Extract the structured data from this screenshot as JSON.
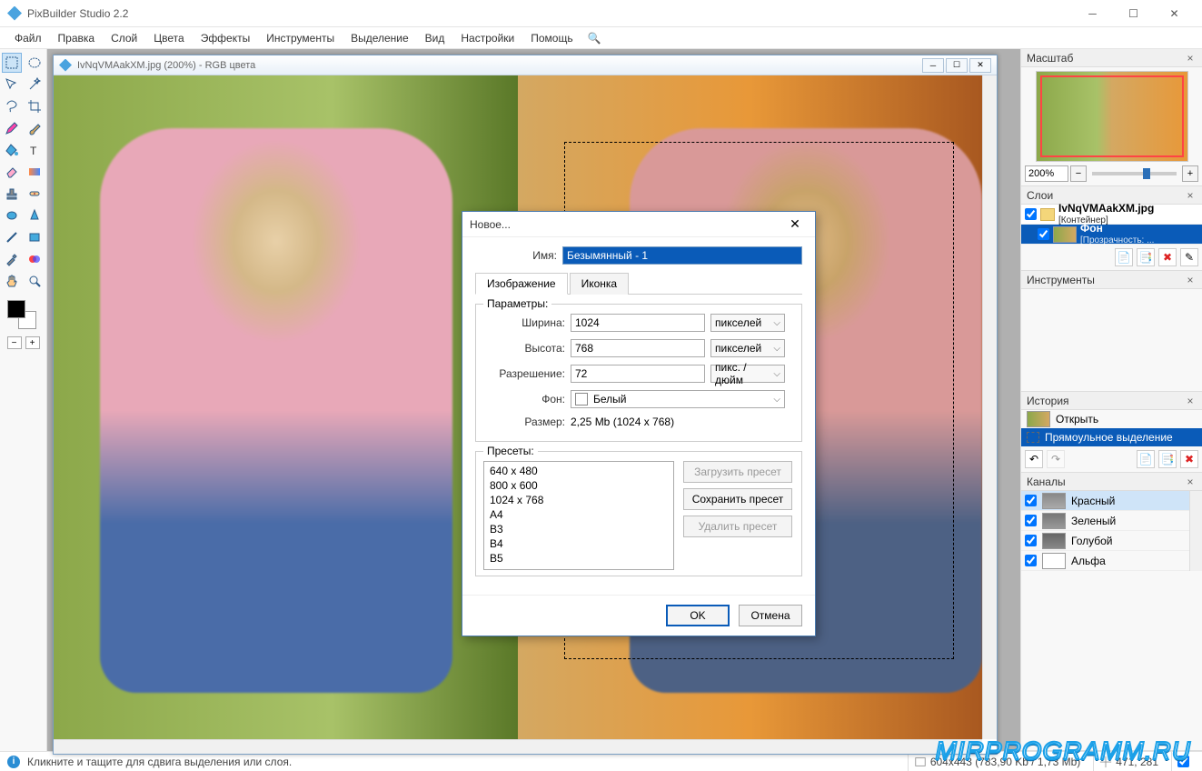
{
  "app": {
    "title": "PixBuilder Studio 2.2"
  },
  "menu": [
    "Файл",
    "Правка",
    "Слой",
    "Цвета",
    "Эффекты",
    "Инструменты",
    "Выделение",
    "Вид",
    "Настройки",
    "Помощь"
  ],
  "doc": {
    "title": "IvNqVMAakXM.jpg (200%) - RGB цвета"
  },
  "panels": {
    "navigator": {
      "title": "Масштаб",
      "zoom": "200%"
    },
    "layers": {
      "title": "Слои",
      "container": {
        "name": "IvNqVMAakXM.jpg",
        "sub": "[Контейнер]"
      },
      "layer": {
        "name": "Фон",
        "sub": "[Прозрачность: ..."
      }
    },
    "tools": {
      "title": "Инструменты"
    },
    "history": {
      "title": "История",
      "items": [
        "Открыть",
        "Прямоульное выделение"
      ]
    },
    "channels": {
      "title": "Каналы",
      "items": [
        "Красный",
        "Зеленый",
        "Голубой",
        "Альфа"
      ]
    }
  },
  "dialog": {
    "title": "Новое...",
    "name_label": "Имя:",
    "name_value": "Безымянный - 1",
    "tabs": [
      "Изображение",
      "Иконка"
    ],
    "params_legend": "Параметры:",
    "width_label": "Ширина:",
    "width_value": "1024",
    "width_unit": "пикселей",
    "height_label": "Высота:",
    "height_value": "768",
    "height_unit": "пикселей",
    "res_label": "Разрешение:",
    "res_value": "72",
    "res_unit": "пикс. / дюйм",
    "bg_label": "Фон:",
    "bg_value": "Белый",
    "size_label": "Размер:",
    "size_value": "2,25 Mb  (1024 x 768)",
    "presets_legend": "Пресеты:",
    "presets": [
      "640 x 480",
      "800 x 600",
      "1024 x 768",
      "A4",
      "B3",
      "B4",
      "B5"
    ],
    "btn_load": "Загрузить пресет",
    "btn_save": "Сохранить пресет",
    "btn_delete": "Удалить пресет",
    "ok": "OK",
    "cancel": "Отмена"
  },
  "status": {
    "hint": "Кликните и тащите для сдвига выделения или слоя.",
    "dims": "604x443  (783,90 Kb / 1,73 Mb)",
    "coords": "471, 281"
  },
  "watermark": "MIRPROGRAMM.RU"
}
